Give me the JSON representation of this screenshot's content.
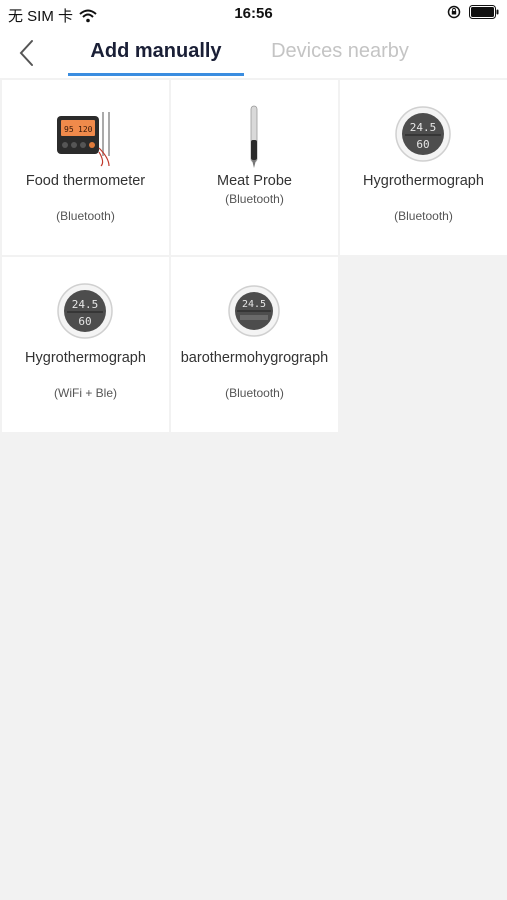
{
  "status_bar": {
    "carrier": "无 SIM 卡",
    "time": "16:56"
  },
  "nav": {
    "tabs": [
      {
        "label": "Add manually",
        "active": true
      },
      {
        "label": "Devices nearby",
        "active": false
      }
    ],
    "accent_color": "#3a8de0"
  },
  "devices": [
    {
      "name": "Food thermometer",
      "connection": "(Bluetooth)",
      "icon": "food-thermometer-icon"
    },
    {
      "name": "Meat Probe",
      "connection": "(Bluetooth)",
      "icon": "meat-probe-icon"
    },
    {
      "name": "Hygrothermograph",
      "connection": "(Bluetooth)",
      "icon": "hygrothermograph-icon"
    },
    {
      "name": "Hygrothermograph",
      "connection": "(WiFi + Ble)",
      "icon": "hygrothermograph-icon"
    },
    {
      "name": "barothermohygrograph",
      "connection": "(Bluetooth)",
      "icon": "barothermohygrograph-icon"
    }
  ],
  "display_readings": {
    "temp": "24.5",
    "humidity": "60",
    "food_temp_a": "95",
    "food_temp_b": "120"
  }
}
